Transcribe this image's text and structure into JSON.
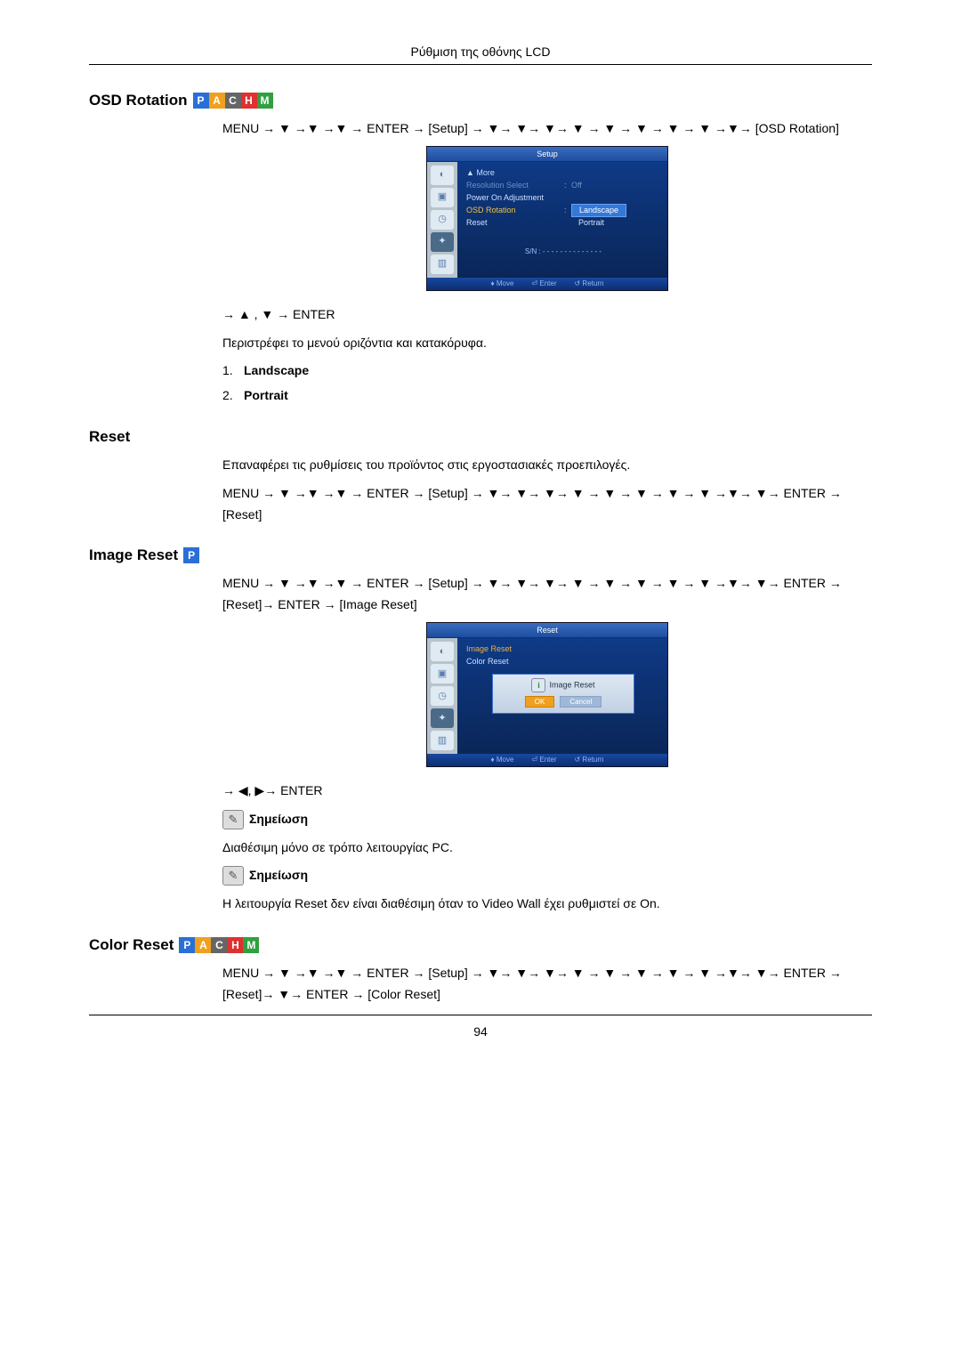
{
  "header": {
    "title": "Ρύθμιση της οθόνης LCD"
  },
  "headings": {
    "osd_rotation": "OSD Rotation",
    "reset": "Reset",
    "image_reset": "Image Reset",
    "color_reset": "Color Reset"
  },
  "badges": {
    "p": "P",
    "a": "A",
    "c": "C",
    "h": "H",
    "m": "M"
  },
  "osd_rotation": {
    "nav_line": "MENU → ▼ →▼ →▼ → ENTER → [Setup] → ▼→ ▼→ ▼→ ▼ → ▼ → ▼ → ▼ → ▼ →▼→ [OSD Rotation]",
    "post_nav": "→ ▲ , ▼ → ENTER",
    "desc": "Περιστρέφει το μενού οριζόντια και κατακόρυφα.",
    "options": [
      {
        "num": "1.",
        "label": "Landscape"
      },
      {
        "num": "2.",
        "label": "Portrait"
      }
    ]
  },
  "reset": {
    "desc": "Επαναφέρει τις ρυθμίσεις του προϊόντος στις εργοστασιακές προεπιλογές.",
    "nav_line": "MENU → ▼ →▼ →▼ → ENTER → [Setup] → ▼→ ▼→ ▼→ ▼ → ▼ → ▼ → ▼ → ▼ →▼→ ▼→ ENTER → [Reset]"
  },
  "image_reset": {
    "nav_line": "MENU → ▼ →▼ →▼ → ENTER → [Setup] → ▼→ ▼→ ▼→ ▼ → ▼ → ▼ → ▼ → ▼ →▼→ ▼→ ENTER → [Reset]→ ENTER → [Image Reset]",
    "post_nav": "→ ◀, ▶→ ENTER",
    "note1_label": "Σημείωση",
    "note1_text": "Διαθέσιμη μόνο σε τρόπο λειτουργίας PC.",
    "note2_label": "Σημείωση",
    "note2_text": "Η λειτουργία Reset δεν είναι διαθέσιμη όταν το Video Wall έχει ρυθμιστεί σε On."
  },
  "color_reset": {
    "nav_line": "MENU → ▼ →▼ →▼ → ENTER → [Setup] → ▼→ ▼→ ▼→ ▼ → ▼ → ▼ → ▼ → ▼ →▼→ ▼→ ENTER → [Reset]→ ▼→ ENTER → [Color Reset]"
  },
  "osd_screenshot1": {
    "title": "Setup",
    "more": "▲ More",
    "rows": {
      "resolution_select": {
        "label": "Resolution Select",
        "value": "Off"
      },
      "power_on_adjustment": {
        "label": "Power On Adjustment"
      },
      "osd_rotation": {
        "label": "OSD Rotation",
        "opt_selected": "Landscape",
        "opt_other": "Portrait"
      },
      "reset": {
        "label": "Reset"
      }
    },
    "sn": "S/N : - - - - - - - - - - - - - -",
    "footer": {
      "move": "Move",
      "enter": "Enter",
      "return": "Return"
    }
  },
  "osd_screenshot2": {
    "title": "Reset",
    "list": {
      "image_reset": "Image Reset",
      "color_reset": "Color Reset"
    },
    "modal": {
      "title": "Image Reset",
      "ok": "OK",
      "cancel": "Cancel"
    },
    "footer": {
      "move": "Move",
      "enter": "Enter",
      "return": "Return"
    }
  },
  "footer": {
    "page_num": "94"
  }
}
